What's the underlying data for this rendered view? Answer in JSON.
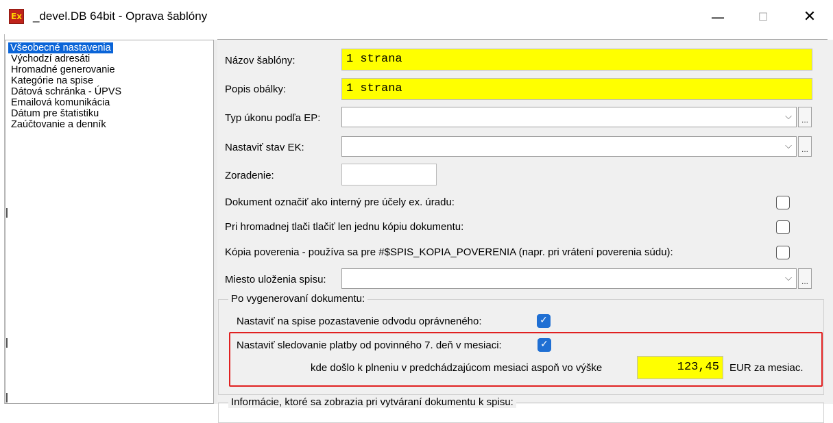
{
  "window": {
    "icon_text": "Ex",
    "title": "_devel.DB 64bit - Oprava šablóny",
    "minimize": "—",
    "maximize": "☐",
    "close": "✕"
  },
  "nav": {
    "items": [
      "Všeobecné nastavenia",
      "Východzí adresáti",
      "Hromadné generovanie",
      "Kategórie na spise",
      "Dátová schránka - ÚPVS",
      "Emailová komunikácia",
      "Dátum pre štatistiku",
      "Zaúčtovanie a denník"
    ]
  },
  "form": {
    "template_name_label": "Názov šablóny:",
    "template_name_value": "1 strana",
    "envelope_label": "Popis obálky:",
    "envelope_value": "1 strana",
    "action_type_label": "Typ úkonu podľa EP:",
    "ek_state_label": "Nastaviť stav EK:",
    "ordering_label": "Zoradenie:",
    "internal_doc_label": "Dokument označiť ako interný pre účely ex. úradu:",
    "internal_doc_checked": false,
    "single_copy_label": "Pri hromadnej tlači tlačiť len jednu kópiu dokumentu:",
    "single_copy_checked": false,
    "authorization_copy_label": "Kópia poverenia - používa sa pre #$SPIS_KOPIA_POVERENIA (napr. pri vrátení poverenia súdu):",
    "authorization_copy_checked": false,
    "storage_label": "Miesto uloženia spisu:",
    "combo_chevron": "⌵",
    "ellipsis": "..."
  },
  "after_generation": {
    "group_title": "Po vygenerovaní dokumentu:",
    "suspend_label": "Nastaviť na spise pozastavenie odvodu oprávneného:",
    "suspend_checked": true,
    "tracking_label": "Nastaviť sledovanie platby od povinného 7. deň v mesiaci:",
    "tracking_checked": true,
    "threshold_prefix": "kde došlo k plneniu v predchádzajúcom mesiaci aspoň vo výške",
    "threshold_value": "123,45",
    "threshold_suffix": "EUR za mesiac."
  },
  "info_group": {
    "title": "Informácie, ktoré sa zobrazia pri vytváraní dokumentu k spisu:"
  },
  "colors": {
    "highlight_field": "#ffff00",
    "selection": "#0a64d8",
    "checkbox_on": "#1f6fd3",
    "annotation_box": "#e02020"
  }
}
